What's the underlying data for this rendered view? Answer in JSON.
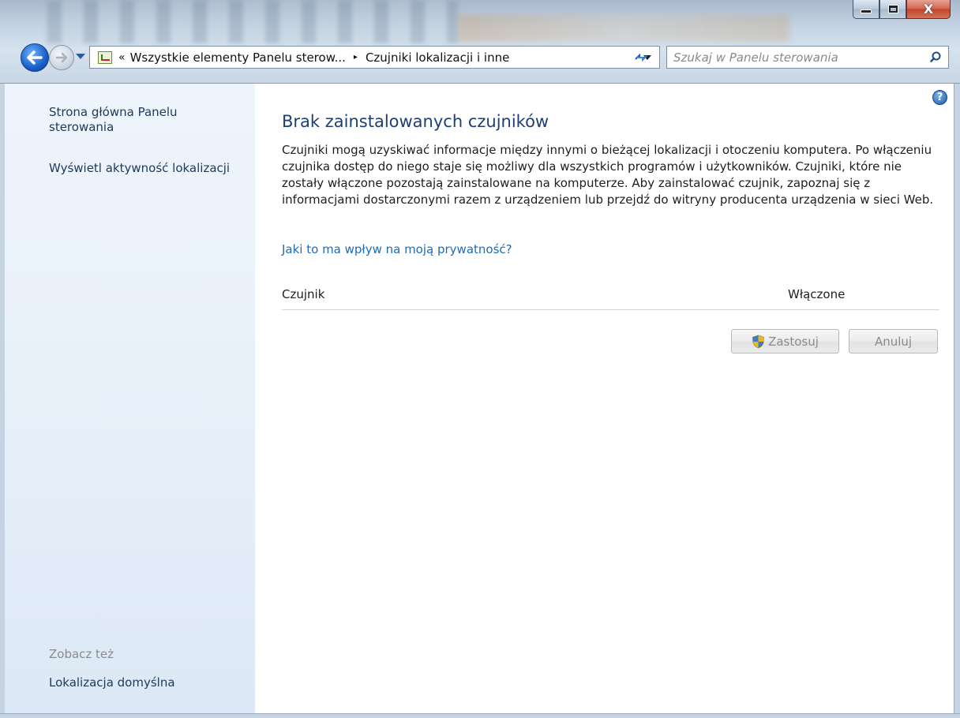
{
  "window": {
    "caption_minimize": "–",
    "caption_maximize": "□",
    "caption_close": "X"
  },
  "address_bar": {
    "overflow_chevron": "«",
    "segments": [
      "Wszystkie elementy Panelu sterow...",
      "Czujniki lokalizacji i inne"
    ],
    "separator": "▸"
  },
  "search": {
    "placeholder": "Szukaj w Panelu sterowania"
  },
  "sidebar": {
    "home_link": "Strona główna Panelu sterowania",
    "activity_link": "Wyświetl aktywność lokalizacji",
    "see_also_label": "Zobacz też",
    "default_location_link": "Lokalizacja domyślna"
  },
  "main": {
    "help": "?",
    "title": "Brak zainstalowanych czujników",
    "description": "Czujniki mogą uzyskiwać informacje między innymi o bieżącej lokalizacji i otoczeniu komputera. Po włączeniu czujnika dostęp do niego staje się możliwy dla wszystkich programów i użytkowników. Czujniki, które nie zostały włączone pozostają zainstalowane na komputerze. Aby zainstalować czujnik, zapoznaj się z informacjami dostarczonymi razem z urządzeniem lub przejdź do witryny producenta urządzenia w sieci Web.",
    "privacy_link": "Jaki to ma wpływ na moją prywatność?",
    "table": {
      "columns": [
        "Czujnik",
        "Włączone"
      ],
      "rows": []
    },
    "buttons": {
      "apply": "Zastosuj",
      "cancel": "Anuluj"
    }
  },
  "colors": {
    "title_blue": "#1e3f73",
    "link_blue": "#1e6bb8",
    "sidebar_link": "#1e395b",
    "sidebar_bg": "#e6eff9"
  }
}
